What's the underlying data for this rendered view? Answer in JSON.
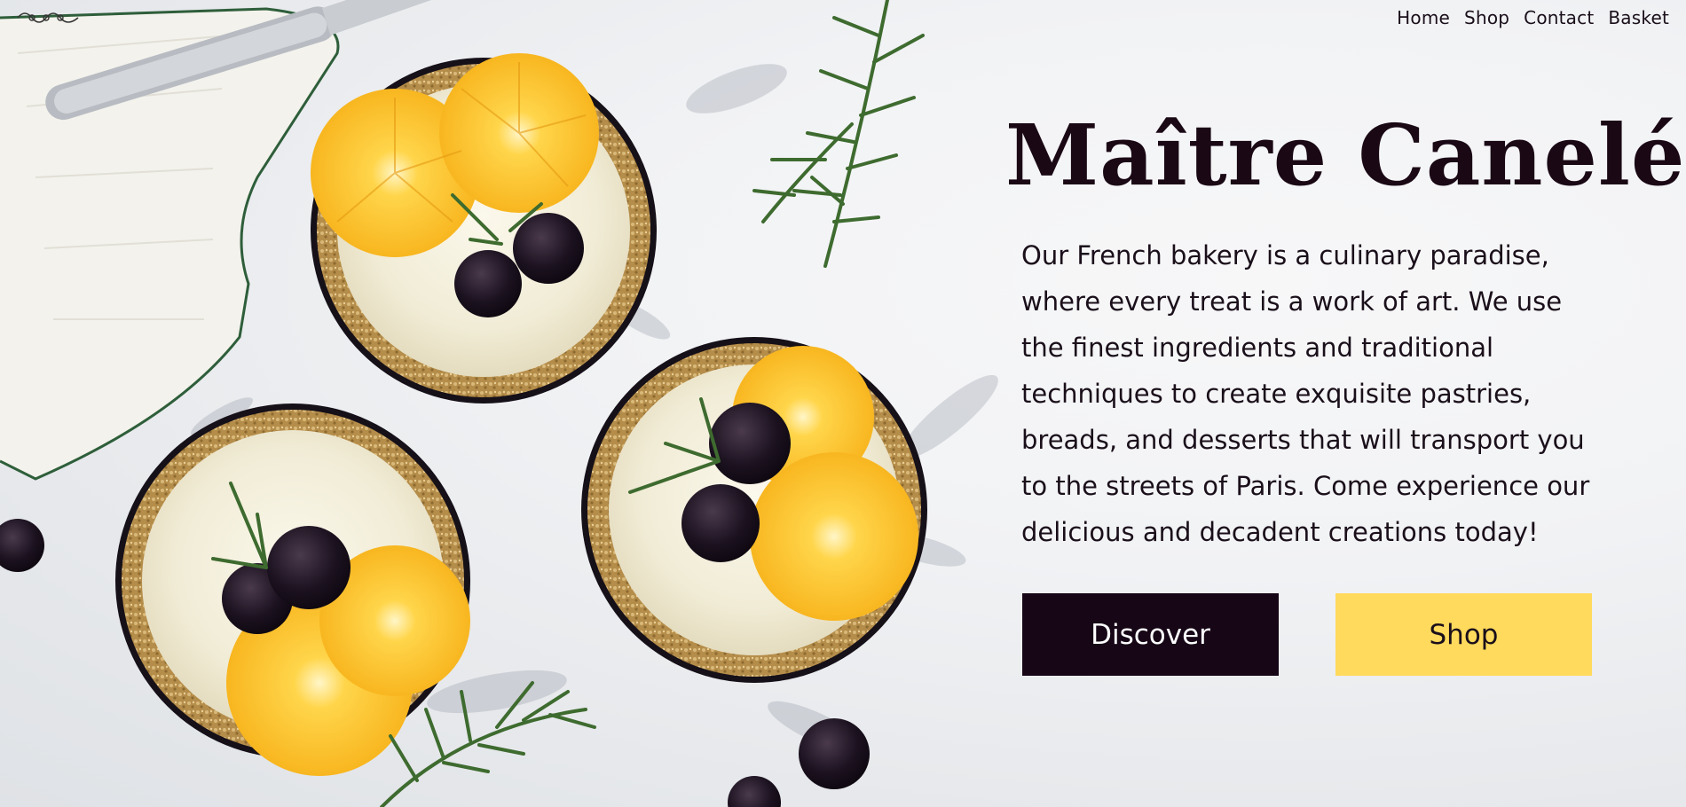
{
  "brand": {
    "logo_icon": "ornament-logo-icon"
  },
  "nav": {
    "items": [
      {
        "label": "Home"
      },
      {
        "label": "Shop"
      },
      {
        "label": "Contact"
      },
      {
        "label": "Basket"
      }
    ]
  },
  "hero": {
    "title": "Maître Canelé",
    "description": "Our French bakery is a culinary paradise, where every treat is a work of art. We use the finest ingredients and traditional techniques to create exquisite pastries, breads, and desserts that will transport you to the streets of Paris. Come experience our delicious and decadent creations today!",
    "primary_button": "Discover",
    "secondary_button": "Shop",
    "image_subject": "citrus-blackberry-tarts-photo"
  },
  "colors": {
    "ink": "#1a0815",
    "primary_button_bg": "#160616",
    "secondary_button_bg": "#ffda5c"
  }
}
